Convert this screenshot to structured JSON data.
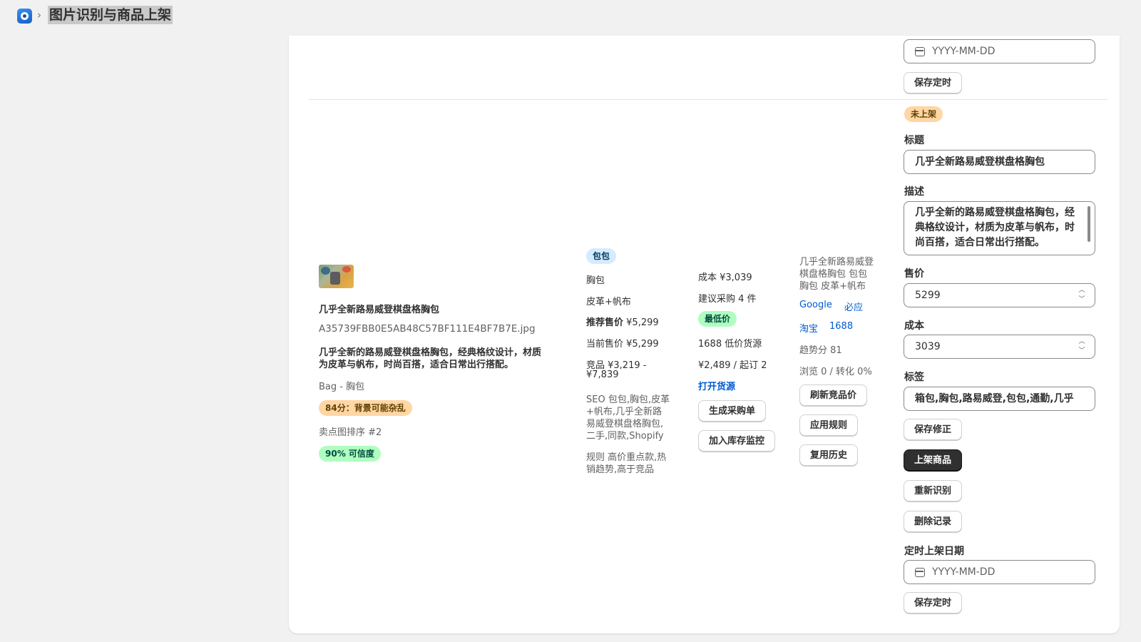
{
  "breadcrumb": {
    "separator": "›",
    "title": "图片识别与商品上架"
  },
  "prev_row": {
    "date_placeholder": "YYYY-MM-DD",
    "save_schedule": "保存定时"
  },
  "product": {
    "name": "几乎全新路易威登棋盘格胸包",
    "filename": "A35739FBB0E5AB48C57BF111E4BF7B7E.jpg",
    "description_lines": [
      "几乎全新的路易威登棋盘格胸包，经典格纹设计，材质",
      "为皮革与帆布，时尚百搭，适合日常出行搭配。"
    ],
    "category_path": "Bag - 胸包",
    "score_badge": "84分：背景可能杂乱",
    "selling_image": "卖点图排序 #2",
    "confidence_badge": "90% 可信度"
  },
  "attributes": {
    "category_tag": "包包",
    "type": "胸包",
    "material": "皮革+帆布",
    "recommended_price_label": "推荐售价",
    "recommended_price": "¥5,299",
    "current_price": "当前售价 ¥5,299",
    "competitor_price_lines": [
      "竞品 ¥3,219 -",
      "¥7,839"
    ],
    "seo_lines": [
      "SEO 包包,胸包,皮革",
      "+帆布,几乎全新路",
      "易威登棋盘格胸包,",
      "二手,同款,Shopify"
    ],
    "rule_lines": [
      "规则 高价重点款,热",
      "销趋势,高于竞品"
    ]
  },
  "sourcing": {
    "cost": "成本 ¥3,039",
    "suggest_purchase": "建议采购 4 件",
    "lowest_badge": "最低价",
    "source_1688": "1688 低价货源",
    "price_moq": "¥2,489 / 起订 2",
    "open_source_link": "打开货源",
    "gen_purchase_button": "生成采购单",
    "add_monitor_button": "加入库存监控"
  },
  "search": {
    "keyword_lines": [
      "几乎全新路易威登",
      "棋盘格胸包 包包",
      "胸包 皮革+帆布"
    ],
    "links": [
      "Google",
      "必应",
      "淘宝",
      "1688"
    ],
    "trend_score": "趋势分 81",
    "views": "浏览 0 / 转化 0%",
    "refresh_button": "刷新竞品价",
    "apply_rule_button": "应用规则",
    "reuse_history_button": "复用历史"
  },
  "form": {
    "status_badge": "未上架",
    "title_label": "标题",
    "title_value": "几乎全新路易威登棋盘格胸包",
    "desc_label": "描述",
    "desc_value": "几乎全新的路易威登棋盘格胸包，经典格纹设计，材质为皮革与帆布，时尚百搭，适合日常出行搭配。",
    "price_label": "售价",
    "price_value": "5299",
    "cost_label": "成本",
    "cost_value": "3039",
    "tags_label": "标签",
    "tags_value": "箱包,胸包,路易威登,包包,通勤,几乎",
    "save_edit_button": "保存修正",
    "publish_button": "上架商品",
    "reidentify_button": "重新识别",
    "delete_button": "删除记录",
    "schedule_label": "定时上架日期",
    "date_placeholder": "YYYY-MM-DD",
    "save_schedule_button": "保存定时"
  },
  "colors": {
    "badge_blue_bg": "#d5ebff",
    "badge_orange_bg": "#ffd6a4",
    "badge_green_bg": "#affebf",
    "link": "#005bd3",
    "primary_button": "#303030"
  },
  "icons": {
    "app": "app-logo-icon",
    "calendar": "calendar-icon",
    "stepper": "chevron-up-down-icon"
  }
}
